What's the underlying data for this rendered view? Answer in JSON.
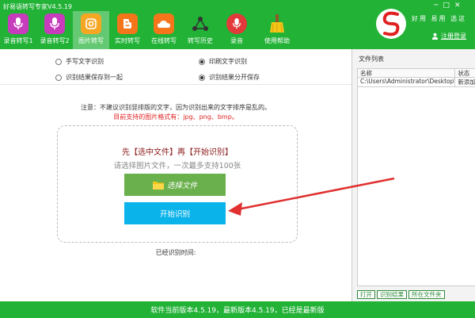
{
  "app": {
    "title": "好易语转写专家V4.5.19"
  },
  "window": {
    "controls": [
      "─",
      "□",
      "✕"
    ]
  },
  "toolbar": {
    "items": [
      {
        "label": "录音转写1",
        "icon": "microphone-icon",
        "color": "#c73cbd"
      },
      {
        "label": "录音转写2",
        "icon": "microphone-icon",
        "color": "#c73cbd"
      },
      {
        "label": "图片转写",
        "icon": "camera-icon",
        "color": "#f5a623",
        "active": true
      },
      {
        "label": "实时转写",
        "icon": "blogger-icon",
        "color": "#f5761a"
      },
      {
        "label": "在线转写",
        "icon": "cloud-icon",
        "color": "#f5761a"
      },
      {
        "label": "转写历史",
        "icon": "network-icon",
        "color": "#333333"
      },
      {
        "label": "录音",
        "icon": "microphone-icon",
        "color": "#e23a3a"
      },
      {
        "label": "使用帮助",
        "icon": "broom-icon",
        "color": "#21b236"
      }
    ]
  },
  "brand": {
    "slogan": "好用 易用 选这",
    "login_label": "注册登录"
  },
  "options": {
    "handwriting": "手写文字识别",
    "printed": "印刷文字识别",
    "save_together": "识别结果保存到一起",
    "save_separate": "识别结果分开保存",
    "selected_mode": "printed",
    "selected_save": "save_separate"
  },
  "notice": {
    "line1": "注意：不建议识别竖排版的文字，因为识别出来的文字排序是乱的。",
    "line2": "目前支持的图片格式有：jpg、png、bmp。"
  },
  "dropzone": {
    "title": "先【选中文件】再【开始识别】",
    "subtitle": "请选择图片文件，一次最多支持100张",
    "select_label": "选择文件",
    "start_label": "开始识别"
  },
  "elapsed_label": "已经识别时间:",
  "file_list": {
    "title": "文件列表",
    "columns": [
      "名称",
      "状态"
    ],
    "rows": [
      {
        "name": "C:\\Users\\Administrator\\Desktop\\",
        "status": "新添加"
      }
    ],
    "buttons": [
      "打开",
      "识别结果",
      "所在文件夹"
    ]
  },
  "footer": {
    "text": "软件当前版本4.5.19，最新版本4.5.19，已经是最新版"
  },
  "colors": {
    "brand_green": "#21b236",
    "start_blue": "#0ab3ea",
    "select_green": "#6ab04c",
    "arrow_red": "#e03030"
  }
}
